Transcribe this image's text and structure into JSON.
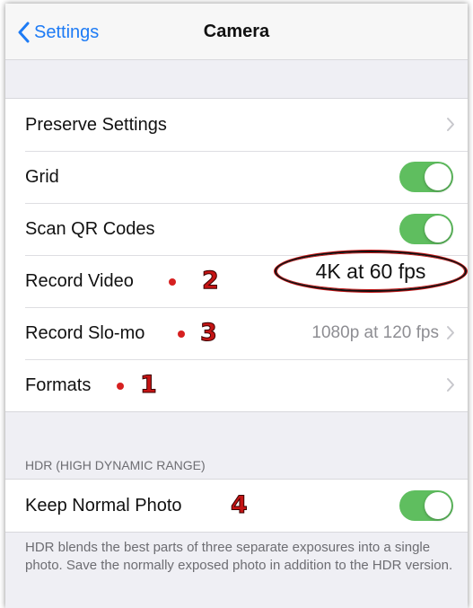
{
  "navbar": {
    "back_label": "Settings",
    "title": "Camera"
  },
  "settings": {
    "preserve_settings": "Preserve Settings",
    "grid": {
      "label": "Grid",
      "enabled": true
    },
    "scan_qr": {
      "label": "Scan QR Codes",
      "enabled": true
    },
    "record_video": {
      "label": "Record Video",
      "value": "4K at 60 fps"
    },
    "record_slomo": {
      "label": "Record Slo-mo",
      "value": "1080p at 120 fps"
    },
    "formats": "Formats"
  },
  "hdr": {
    "header": "HDR (HIGH DYNAMIC RANGE)",
    "keep_normal": {
      "label": "Keep Normal Photo",
      "enabled": true
    },
    "footer": "HDR blends the best parts of three separate exposures into a single photo. Save the normally exposed photo in addition to the HDR version."
  },
  "annotations": {
    "formats": "1",
    "record_video": "2",
    "record_slomo": "3",
    "keep_normal": "4"
  },
  "colors": {
    "accent": "#1d7bf5",
    "toggle_on": "#5fbe5f",
    "annotation": "#c41414"
  }
}
